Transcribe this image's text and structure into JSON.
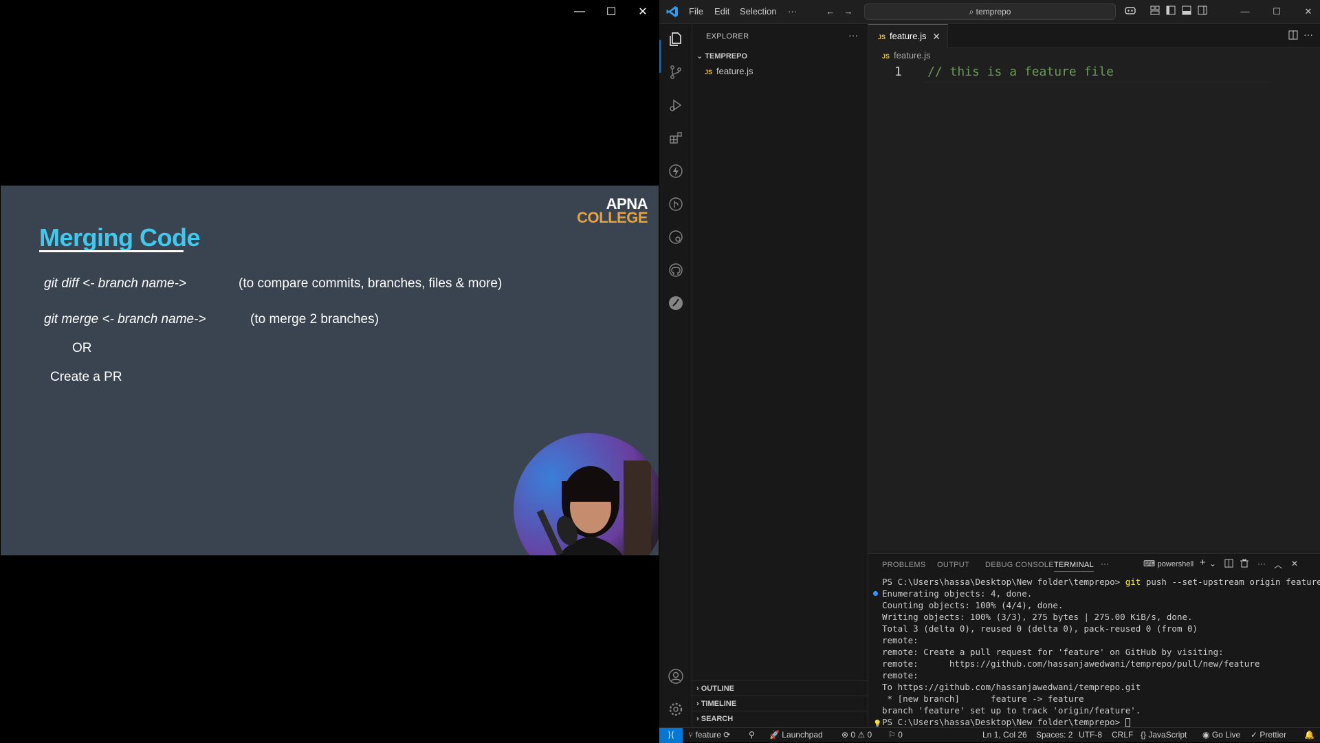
{
  "slide_window": {
    "controls": {
      "minimize": "—",
      "maximize": "☐",
      "close": "✕"
    }
  },
  "slide": {
    "title": "Merging Code",
    "logo_line1": "APNA",
    "logo_line2": "COLLEGE",
    "line1_cmd": "git diff <- branch name->",
    "line1_desc": "(to compare commits, branches, files & more)",
    "line2_cmd": "git merge <- branch name->",
    "line2_desc": "(to merge 2 branches)",
    "or": "OR",
    "pr": "Create a PR"
  },
  "vscode": {
    "menu": {
      "file": "File",
      "edit": "Edit",
      "selection": "Selection",
      "more": "···"
    },
    "search_text": "temprepo",
    "explorer": {
      "header": "EXPLORER",
      "folder": "TEMPREPO",
      "files": [
        {
          "icon": "JS",
          "name": "feature.js"
        }
      ],
      "sections": {
        "outline": "OUTLINE",
        "timeline": "TIMELINE",
        "search": "SEARCH"
      }
    },
    "editor": {
      "tab": "feature.js",
      "tab_icon": "JS",
      "breadcrumb": "feature.js",
      "line_number": "1",
      "code": "// this is a feature file"
    },
    "panel": {
      "tabs": {
        "problems": "PROBLEMS",
        "output": "OUTPUT",
        "debug": "DEBUG CONSOLE",
        "terminal": "TERMINAL"
      },
      "shell": "powershell",
      "terminal_prompt": "PS C:\\Users\\hassa\\Desktop\\New folder\\temprepo>",
      "terminal_command": "git push --set-upstream origin feature",
      "terminal_lines": [
        "Enumerating objects: 4, done.",
        "Counting objects: 100% (4/4), done.",
        "Writing objects: 100% (3/3), 275 bytes | 275.00 KiB/s, done.",
        "Total 3 (delta 0), reused 0 (delta 0), pack-reused 0 (from 0)",
        "remote:",
        "remote: Create a pull request for 'feature' on GitHub by visiting:",
        "remote:      https://github.com/hassanjawedwani/temprepo/pull/new/feature",
        "remote:",
        "To https://github.com/hassanjawedwani/temprepo.git",
        " * [new branch]      feature -> feature",
        "branch 'feature' set up to track 'origin/feature'."
      ],
      "final_prompt": "PS C:\\Users\\hassa\\Desktop\\New folder\\temprepo>"
    },
    "status": {
      "branch": "feature",
      "launchpad": "Launchpad",
      "errors": "0",
      "warnings": "0",
      "ports": "0",
      "position": "Ln 1, Col 26",
      "spaces": "Spaces: 2",
      "encoding": "UTF-8",
      "eol": "CRLF",
      "language": "JavaScript",
      "golive": "Go Live",
      "prettier": "Prettier"
    }
  }
}
